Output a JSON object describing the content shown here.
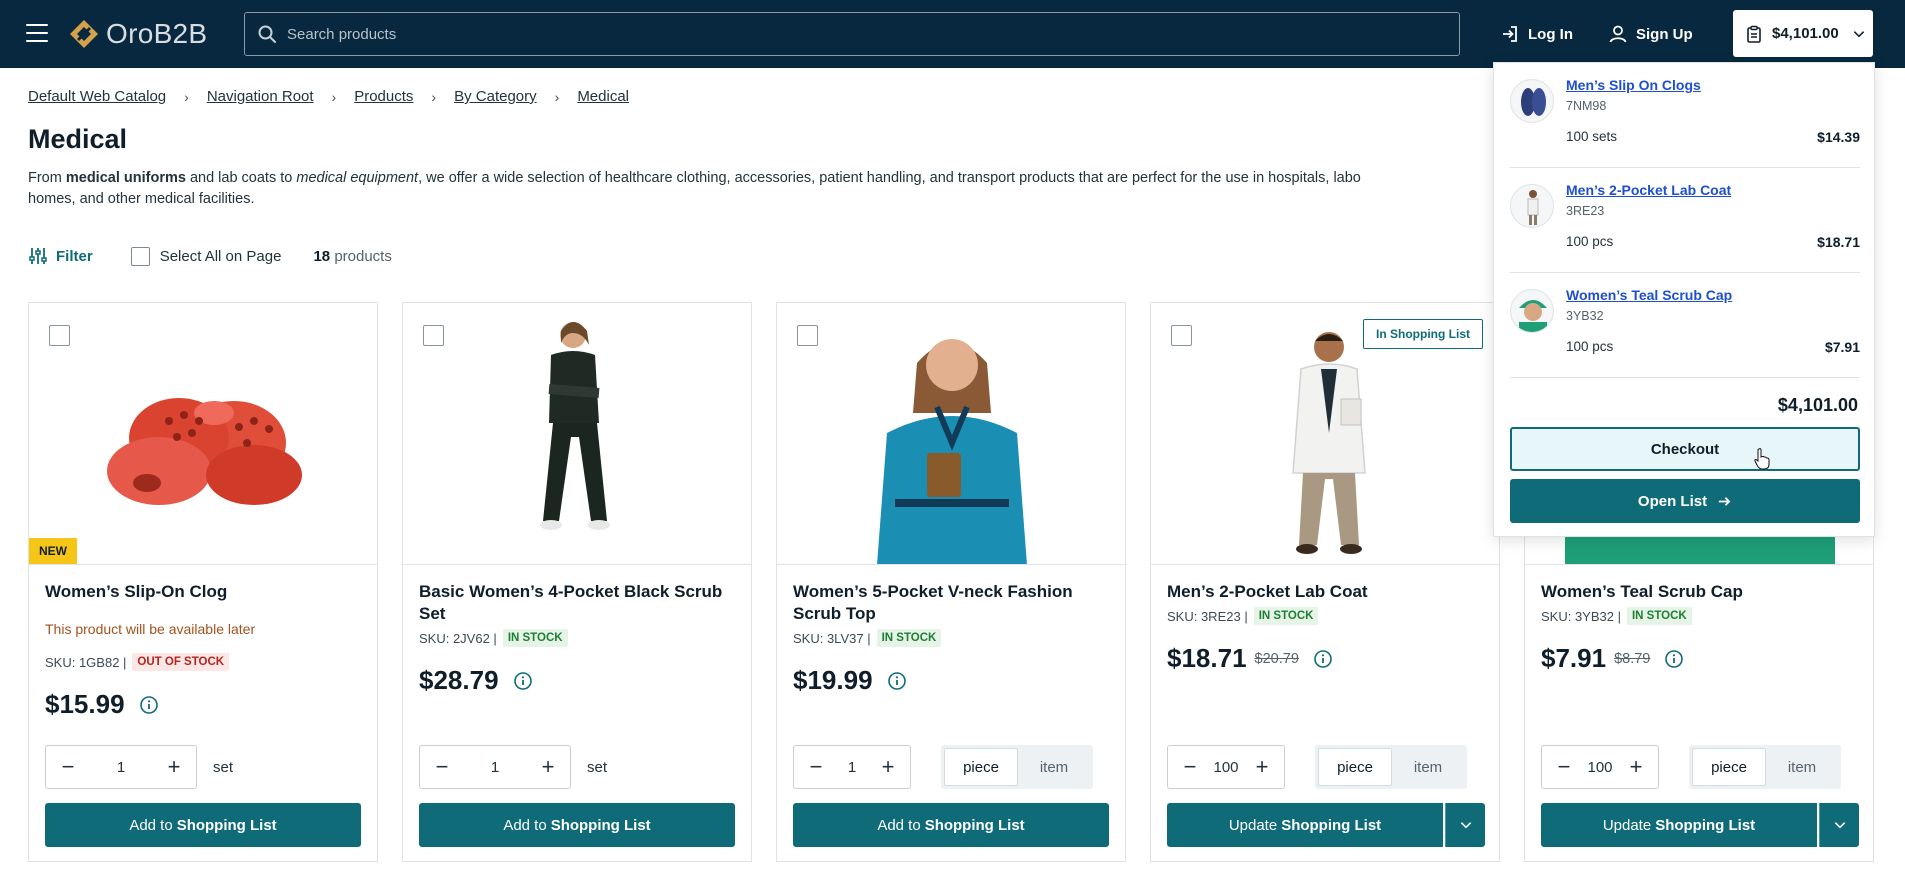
{
  "header": {
    "logo_text": "OroB2B",
    "search_placeholder": "Search products",
    "login_label": "Log In",
    "signup_label": "Sign Up",
    "cart_total": "$4,101.00"
  },
  "breadcrumb": [
    "Default Web Catalog",
    "Navigation Root",
    "Products",
    "By Category",
    "Medical"
  ],
  "page": {
    "title": "Medical",
    "desc_from": "From ",
    "desc_bold1": "medical uniforms",
    "desc_mid": " and lab coats to ",
    "desc_italic": "medical equipment",
    "desc_rest": ", we offer a wide selection of healthcare clothing, accessories, patient handling, and transport products that are perfect for the use in hospitals, labo",
    "desc_line2": "homes, and other medical facilities."
  },
  "toolbar": {
    "filter_label": "Filter",
    "select_all_label": "Select All on Page",
    "count_number": "18",
    "count_suffix": "products"
  },
  "products": [
    {
      "name": "Women’s Slip-On Clog",
      "badge": "NEW",
      "availability": "This product will be available later",
      "sku": "SKU: 1GB82 |",
      "stock": "OUT OF STOCK",
      "price": "$15.99",
      "old_price": "",
      "qty": "1",
      "unit": "set",
      "action_prefix": "Add to",
      "action_main": "Shopping List"
    },
    {
      "name": "Basic Women’s 4-Pocket Black Scrub Set",
      "sku": "SKU: 2JV62 |",
      "stock": "IN STOCK",
      "price": "$28.79",
      "old_price": "",
      "qty": "1",
      "unit": "set",
      "action_prefix": "Add to",
      "action_main": "Shopping List"
    },
    {
      "name": "Women’s 5-Pocket V-neck Fashion Scrub Top",
      "sku": "SKU: 3LV37 |",
      "stock": "IN STOCK",
      "price": "$19.99",
      "old_price": "",
      "qty": "1",
      "unit_options": [
        "piece",
        "item"
      ],
      "action_prefix": "Add to",
      "action_main": "Shopping List"
    },
    {
      "name": "Men’s 2-Pocket Lab Coat",
      "badge": "In Shopping List",
      "sku": "SKU: 3RE23 |",
      "stock": "IN STOCK",
      "price": "$18.71",
      "old_price": "$20.79",
      "qty": "100",
      "unit_options": [
        "piece",
        "item"
      ],
      "action_prefix": "Update",
      "action_main": "Shopping List"
    },
    {
      "name": "Women’s Teal Scrub Cap",
      "sku": "SKU: 3YB32 |",
      "stock": "IN STOCK",
      "price": "$7.91",
      "old_price": "$8.79",
      "qty": "100",
      "unit_options": [
        "piece",
        "item"
      ],
      "action_prefix": "Update",
      "action_main": "Shopping List"
    }
  ],
  "cart_dropdown": {
    "items": [
      {
        "name": "Men’s Slip On Clogs",
        "sku": "7NM98",
        "qty": "100 sets",
        "price": "$14.39"
      },
      {
        "name": "Men’s 2-Pocket Lab Coat",
        "sku": "3RE23",
        "qty": "100 pcs",
        "price": "$18.71"
      },
      {
        "name": "Women’s Teal Scrub Cap",
        "sku": "3YB32",
        "qty": "100 pcs",
        "price": "$7.91"
      }
    ],
    "total": "$4,101.00",
    "checkout_label": "Checkout",
    "open_list_label": "Open List"
  },
  "colors": {
    "header_bg": "#07283e",
    "primary": "#0f6b78",
    "new_badge": "#f5c518",
    "link_blue": "#1f4fd1"
  }
}
